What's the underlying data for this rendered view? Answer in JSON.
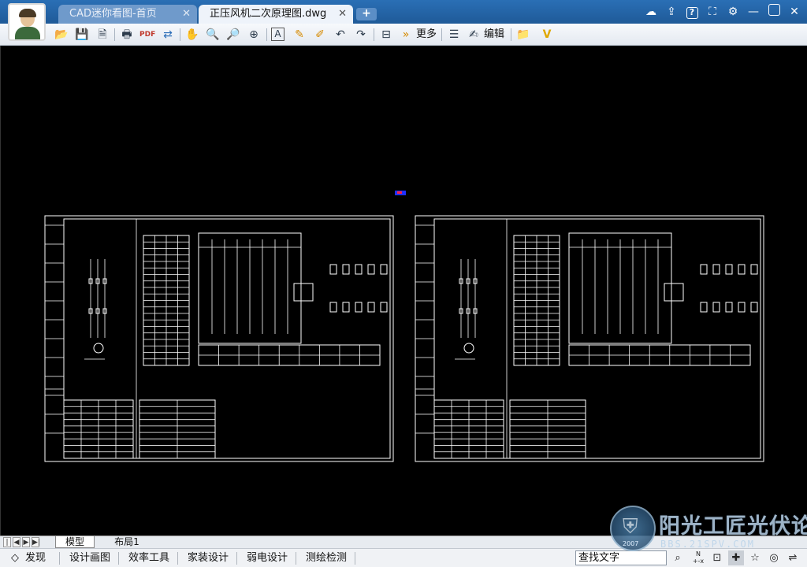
{
  "tabs": [
    {
      "label": "CAD迷你看图-首页",
      "close": "✕"
    },
    {
      "label": "正压风机二次原理图.dwg",
      "close": "✕"
    }
  ],
  "new_tab": "+",
  "toolbar": {
    "more_label": "更多",
    "edit_label": "编辑"
  },
  "layout_tabs": [
    "模型",
    "布局1"
  ],
  "bottom_menu": [
    "发现",
    "设计画图",
    "效率工具",
    "家装设计",
    "弱电设计",
    "测绘检测"
  ],
  "search": {
    "value": "查找文字"
  },
  "watermark": {
    "text": "阳光工匠光伏论坛",
    "sub": "BBS.21SPV.COM",
    "year": "2007"
  },
  "icons": {
    "window": [
      "cloud-icon",
      "share-icon",
      "help-icon",
      "fullscreen-icon",
      "settings-icon",
      "minimize-icon",
      "maximize-icon",
      "close-icon"
    ],
    "toolbar": [
      "open-icon",
      "save-icon",
      "save-as-icon",
      "print-icon",
      "pdf-icon",
      "convert-icon",
      "pan-icon",
      "zoom-in-icon",
      "zoom-window-icon",
      "zoom-extents-icon",
      "text-icon",
      "pen-icon",
      "markup-icon",
      "undo-icon",
      "redo-icon",
      "measure-icon",
      "more-icon",
      "layers-icon",
      "edit-icon",
      "folder-icon",
      "vip-icon"
    ]
  },
  "colors": {
    "accent": "#2a6fb5",
    "canvas": "#000000",
    "drawing_lines": "#ffffff"
  }
}
